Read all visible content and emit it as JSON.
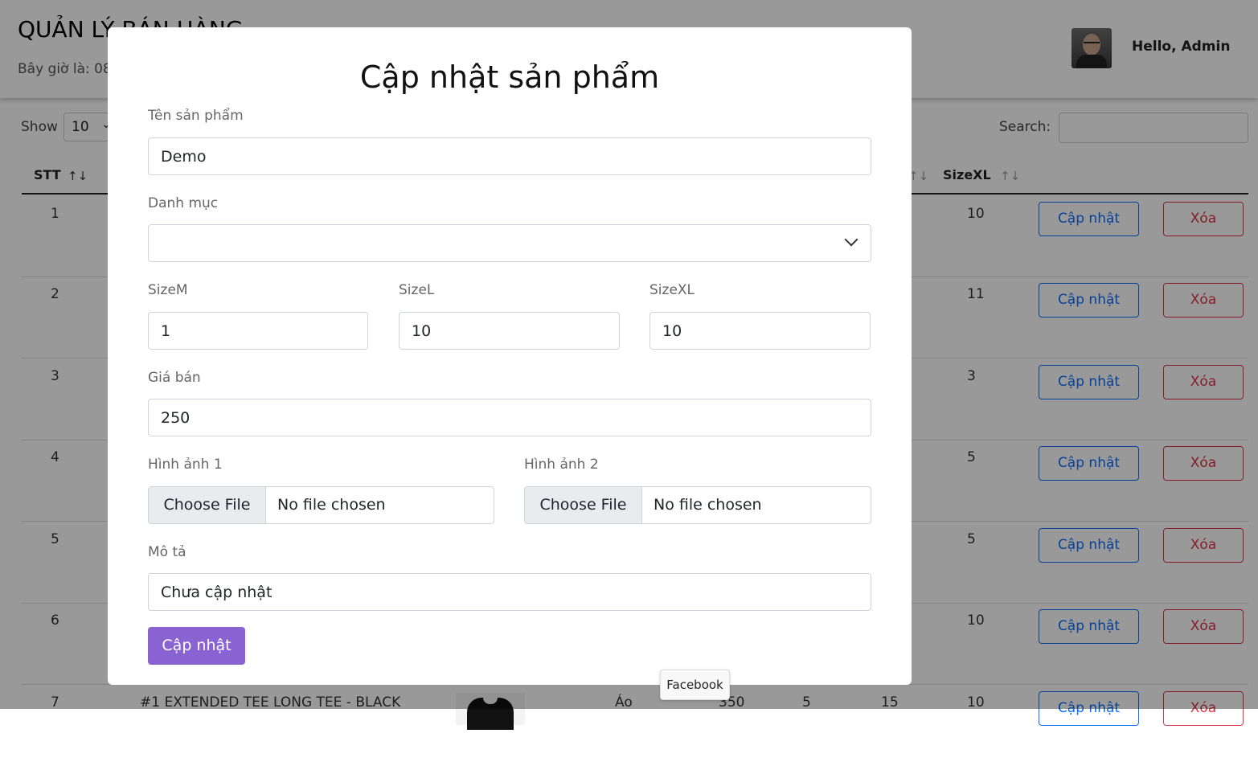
{
  "header": {
    "title": "QUẢN LÝ BÁN HÀNG",
    "time_label": "Bây giờ là: 08",
    "greeting": "Hello, Admin"
  },
  "table_controls": {
    "show_label": "Show",
    "show_value": "10",
    "search_label": "Search:",
    "search_value": ""
  },
  "table": {
    "columns": {
      "stt": "STT",
      "sizexl": "SizeXL"
    },
    "edit_label": "Cập nhật",
    "delete_label": "Xóa",
    "rows": [
      {
        "stt": "1",
        "sizexl": "10"
      },
      {
        "stt": "2",
        "sizexl": "11"
      },
      {
        "stt": "3",
        "sizexl": "3"
      },
      {
        "stt": "4",
        "sizexl": "5"
      },
      {
        "stt": "5",
        "sizexl": "5"
      },
      {
        "stt": "6",
        "sizexl": "10"
      },
      {
        "stt": "7",
        "name": "#1 EXTENDED TEE LONG TEE - BLACK",
        "category": "Áo",
        "price": "350",
        "sizem": "5",
        "sizel": "15",
        "sizexl": "10"
      }
    ]
  },
  "modal": {
    "title": "Cập nhật sản phẩm",
    "name_label": "Tên sản phẩm",
    "name_value": "Demo",
    "category_label": "Danh mục",
    "category_value": "",
    "sizem_label": "SizeM",
    "sizem_value": "1",
    "sizel_label": "SizeL",
    "sizel_value": "10",
    "sizexl_label": "SizeXL",
    "sizexl_value": "10",
    "price_label": "Giá bán",
    "price_value": "250",
    "image1_label": "Hình ảnh 1",
    "image2_label": "Hình ảnh 2",
    "choose_file_label": "Choose File",
    "no_file_label": "No file chosen",
    "desc_label": "Mô tả",
    "desc_value": "Chưa cập nhật",
    "submit_label": "Cập nhật"
  },
  "tooltip": {
    "text": "Facebook"
  }
}
